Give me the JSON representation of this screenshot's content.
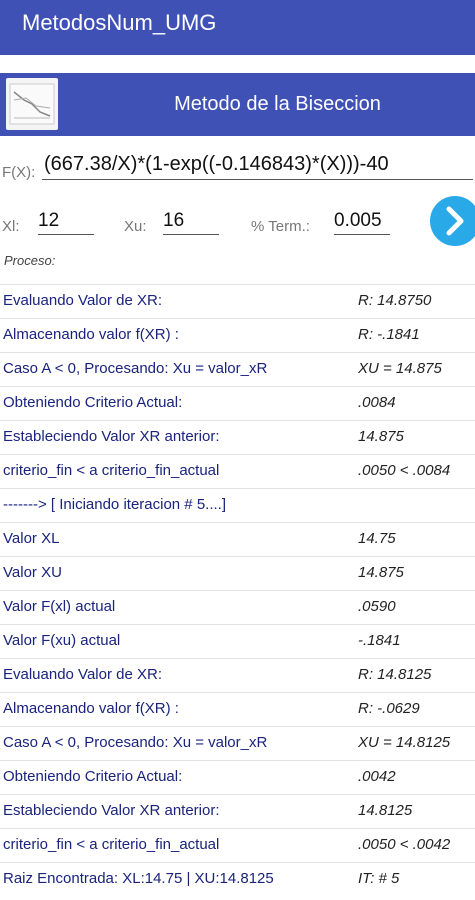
{
  "app": {
    "title": "MetodosNum_UMG"
  },
  "banner": {
    "title": "Metodo de la Biseccion"
  },
  "form": {
    "fx_label": "F(X):",
    "fx_value": "(667.38/X)*(1-exp((-0.146843)*(X)))-40",
    "xl_label": "Xl:",
    "xl_value": "12",
    "xu_label": "Xu:",
    "xu_value": "16",
    "term_label": "% Term.:",
    "term_value": "0.005"
  },
  "proceso_label": "Proceso:",
  "process_rows": [
    {
      "label": "Evaluando Valor de XR:",
      "value": "R: 14.8750"
    },
    {
      "label": "Almacenando valor f(XR) :",
      "value": "R: -.1841"
    },
    {
      "label": "Caso A < 0, Procesando: Xu = valor_xR",
      "value": "XU = 14.875"
    },
    {
      "label": "Obteniendo Criterio Actual:",
      "value": ".0084"
    },
    {
      "label": "Estableciendo Valor XR anterior:",
      "value": "14.875"
    },
    {
      "label": "criterio_fin < a  criterio_fin_actual",
      "value": ".0050 <  .0084"
    },
    {
      "label": "------->  [ Iniciando iteracion # 5....]",
      "value": ""
    },
    {
      "label": "Valor XL",
      "value": "14.75"
    },
    {
      "label": "Valor XU",
      "value": "14.875"
    },
    {
      "label": "Valor F(xl) actual",
      "value": ".0590"
    },
    {
      "label": "Valor F(xu) actual",
      "value": "-.1841"
    },
    {
      "label": "Evaluando Valor de XR:",
      "value": "R: 14.8125"
    },
    {
      "label": "Almacenando valor f(XR) :",
      "value": "R: -.0629"
    },
    {
      "label": "Caso A < 0, Procesando: Xu = valor_xR",
      "value": "XU = 14.8125"
    },
    {
      "label": "Obteniendo Criterio Actual:",
      "value": ".0042"
    },
    {
      "label": "Estableciendo Valor XR anterior:",
      "value": "14.8125"
    },
    {
      "label": "criterio_fin < a  criterio_fin_actual",
      "value": ".0050 <  .0042"
    },
    {
      "label": "Raiz Encontrada: XL:14.75 | XU:14.8125",
      "value": "IT: # 5"
    }
  ]
}
